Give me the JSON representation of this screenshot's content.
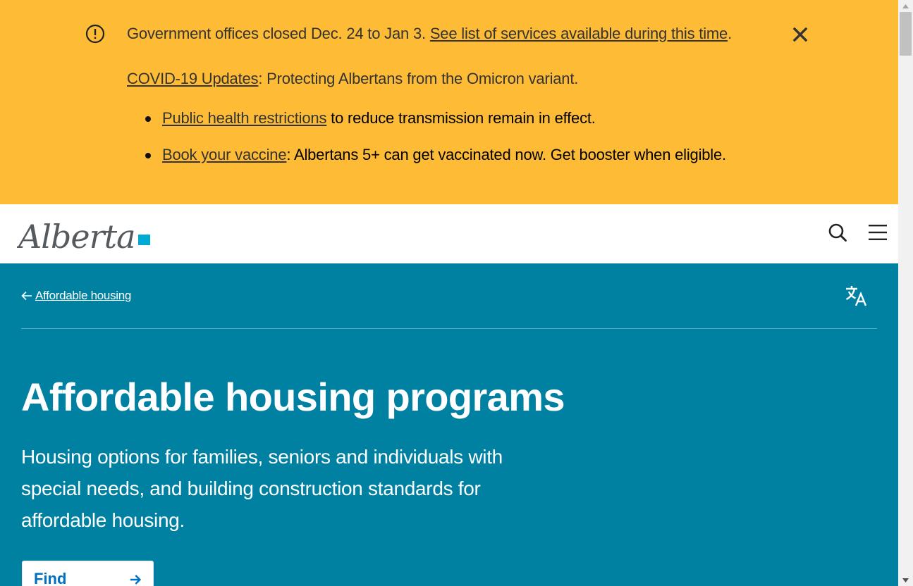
{
  "alert": {
    "icon": "exclamation-circle-icon",
    "line1_text": "Government offices closed Dec. 24 to Jan 3. ",
    "line1_link": "See list of services available during this time",
    "line1_after": ".",
    "line2_link": "COVID-19 Updates",
    "line2_text": ": Protecting Albertans from the Omicron variant.",
    "bullets": [
      {
        "link": "Public health restrictions",
        "text": " to reduce transmission remain in effect."
      },
      {
        "link": "Book your vaccine",
        "text": ": Albertans 5+ can get vaccinated now. Get booster when eligible."
      }
    ],
    "close_icon": "close-icon",
    "background": "#febc36"
  },
  "header": {
    "logo_text": "Alberta",
    "search_icon": "search-icon",
    "menu_icon": "hamburger-menu-icon"
  },
  "hero": {
    "breadcrumb_link": "Affordable housing",
    "translate_icon": "translate-icon",
    "title": "Affordable housing programs",
    "description": "Housing options for families, seniors and individuals with special needs, and building construction standards for affordable housing.",
    "cta_label": "Find housing",
    "background": "#0081a2"
  },
  "colors": {
    "accent": "#00aad2",
    "link_blue": "#0070c4"
  }
}
